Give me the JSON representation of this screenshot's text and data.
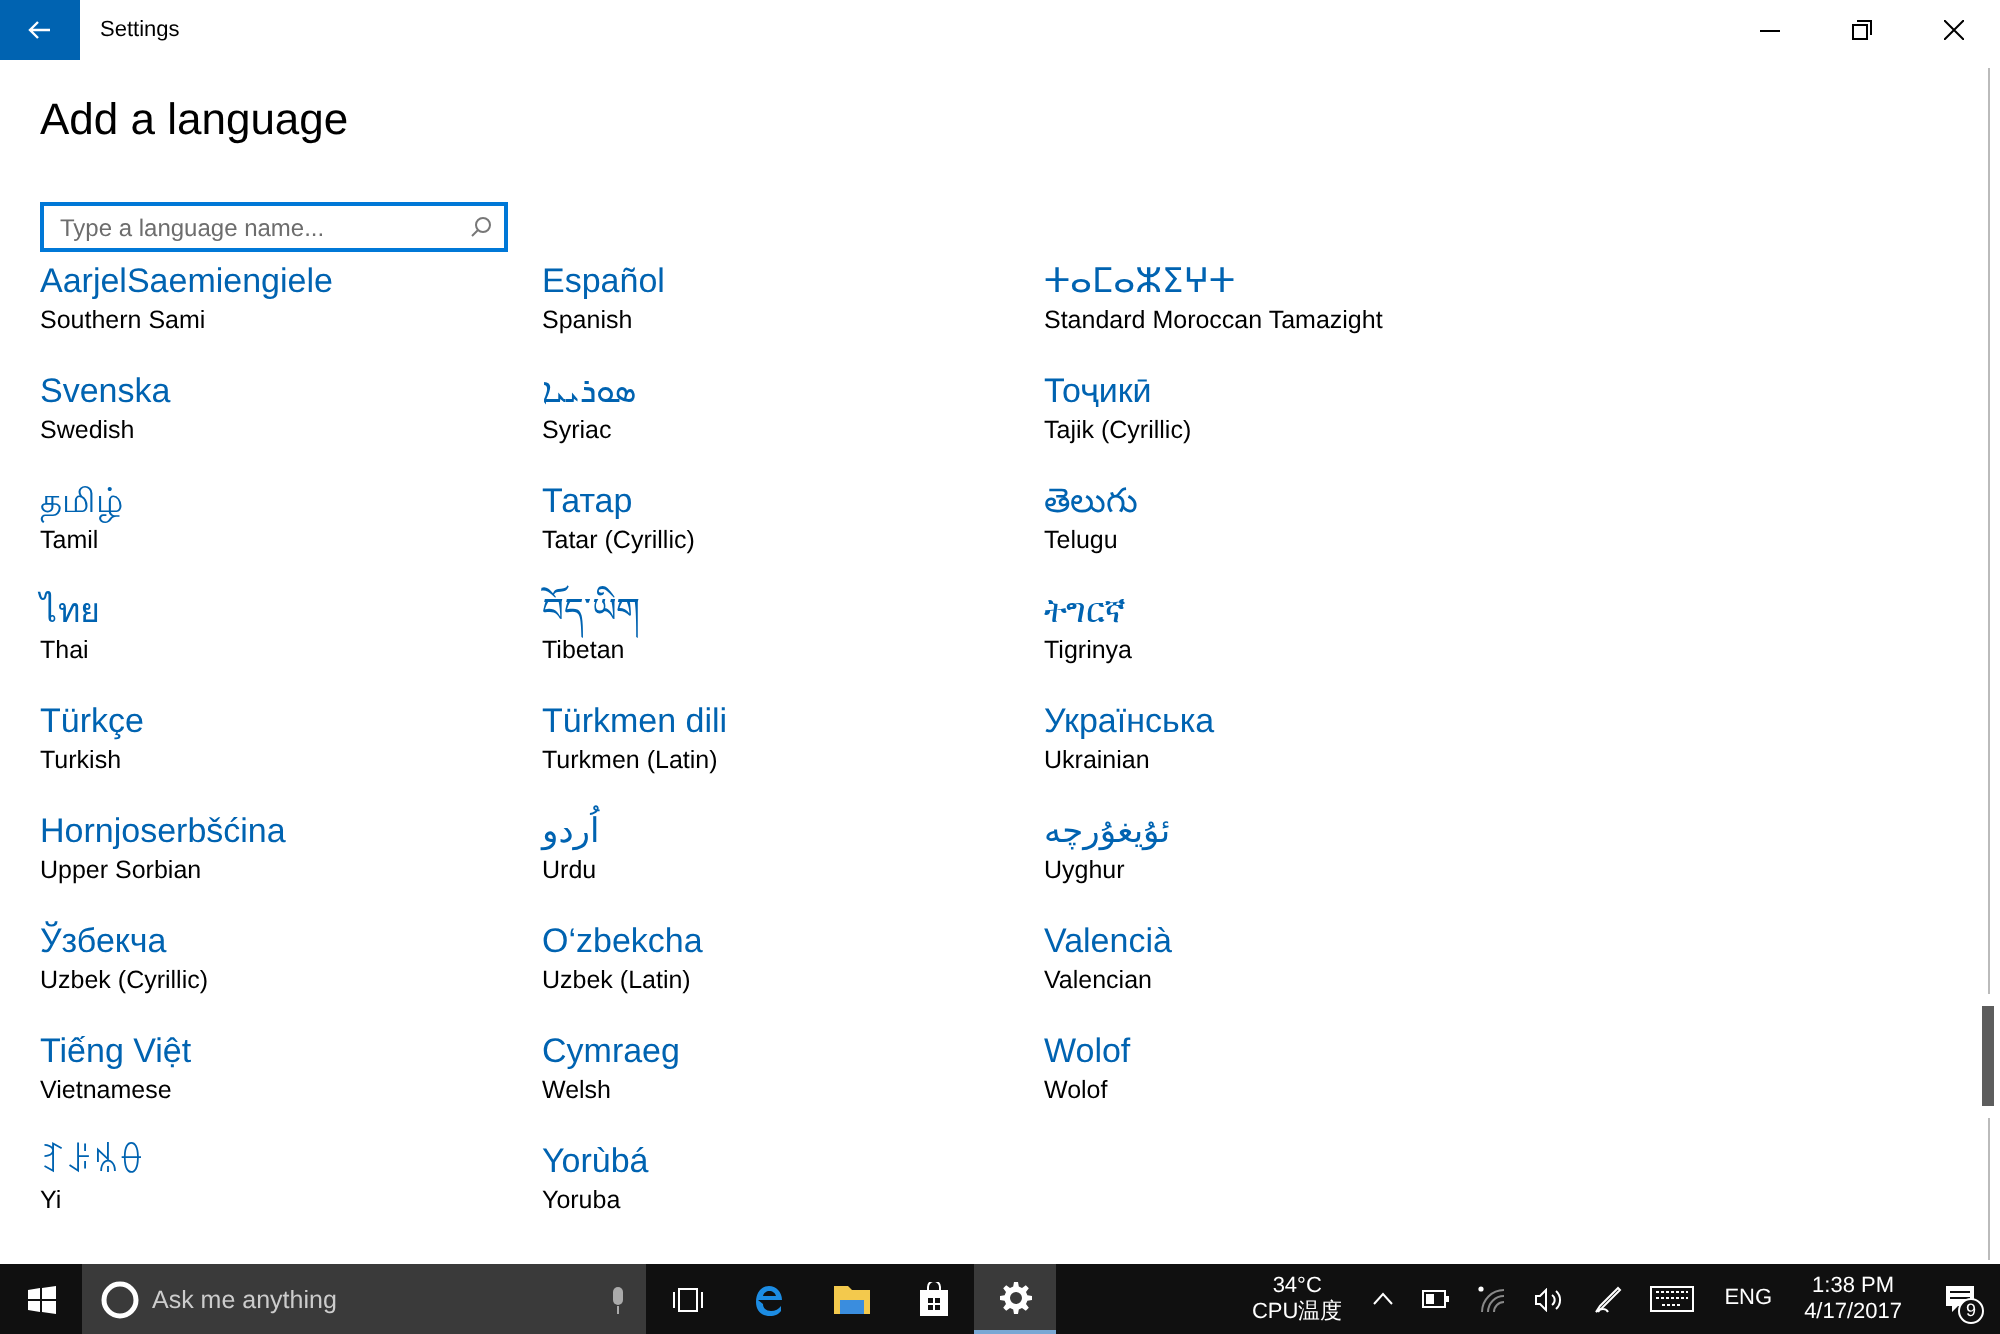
{
  "window": {
    "title": "Settings"
  },
  "heading": "Add a language",
  "search": {
    "placeholder": "Type a language name..."
  },
  "languages": [
    {
      "native": "AarjelSaemiengiele",
      "english": "Southern Sami"
    },
    {
      "native": "Svenska",
      "english": "Swedish"
    },
    {
      "native": "தமிழ்",
      "english": "Tamil"
    },
    {
      "native": "ไทย",
      "english": "Thai"
    },
    {
      "native": "Türkçe",
      "english": "Turkish"
    },
    {
      "native": "Hornjoserbšćina",
      "english": "Upper Sorbian"
    },
    {
      "native": "Ўзбекча",
      "english": "Uzbek (Cyrillic)"
    },
    {
      "native": "Tiếng Việt",
      "english": "Vietnamese"
    },
    {
      "native": "ꆈꌠꁱꂷ",
      "english": "Yi"
    },
    {
      "native": "Español",
      "english": "Spanish"
    },
    {
      "native": "ܣܘܪܝܝܐ",
      "english": "Syriac"
    },
    {
      "native": "Татар",
      "english": "Tatar (Cyrillic)"
    },
    {
      "native": "བོད་ཡིག",
      "english": "Tibetan"
    },
    {
      "native": "Türkmen dili",
      "english": "Turkmen (Latin)"
    },
    {
      "native": "اُردو",
      "english": "Urdu"
    },
    {
      "native": "O‘zbekcha",
      "english": "Uzbek (Latin)"
    },
    {
      "native": "Cymraeg",
      "english": "Welsh"
    },
    {
      "native": "Yorùbá",
      "english": "Yoruba"
    },
    {
      "native": "ⵜⴰⵎⴰⵣⵉⵖⵜ",
      "english": "Standard Moroccan Tamazight"
    },
    {
      "native": "Тоҷикӣ",
      "english": "Tajik (Cyrillic)"
    },
    {
      "native": "తెలుగు",
      "english": "Telugu"
    },
    {
      "native": "ትግርኛ",
      "english": "Tigrinya"
    },
    {
      "native": "Українська",
      "english": "Ukrainian"
    },
    {
      "native": "ئۇيغۇرچە",
      "english": "Uyghur"
    },
    {
      "native": "Valencià",
      "english": "Valencian"
    },
    {
      "native": "Wolof",
      "english": "Wolof"
    }
  ],
  "taskbar": {
    "search_placeholder": "Ask me anything",
    "temperature": "34°C",
    "sensor_label": "CPU温度",
    "language": "ENG",
    "time": "1:38 PM",
    "date": "4/17/2017",
    "notification_count": "9"
  }
}
